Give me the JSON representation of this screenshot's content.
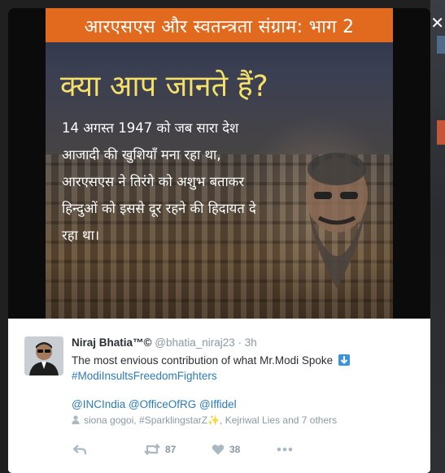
{
  "media": {
    "banner": "आरएसएस और स्वतन्त्रता संग्राम: भाग 2",
    "heading": "क्या आप जानते हैं?",
    "lines": [
      "14 अगस्त 1947 को जब सारा देश",
      "आजादी की खुशियाँ मना रहा था,",
      "आरएसएस ने तिरंगे को अशुभ बताकर",
      "हिन्दुओं को इससे दूर रहने की हिदायत दे",
      "रहा था।"
    ]
  },
  "tweet": {
    "name": "Niraj Bhatia™©",
    "handle": "@bhatia_niraj23",
    "separator": "·",
    "time": "3h",
    "text": "The most envious contribution of what Mr.Modi Spoke",
    "hashtag": "#ModiInsultsFreedomFighters",
    "mentions": "@INCIndia @OfficeOfRG @Iffidel",
    "liked_by_prefix": "siona gogoi, #SparklingstarZ",
    "liked_by_suffix": ", Kejriwal Lies and 7 others",
    "retweet_count": "87",
    "like_count": "38"
  },
  "icons": [
    "close-icon",
    "down-arrow-emoji-icon",
    "person-icon",
    "sparkles-emoji-icon",
    "reply-icon",
    "retweet-icon",
    "like-icon",
    "more-icon"
  ],
  "colors": {
    "accent": "#2b7bb9",
    "banner": "#e26a1e",
    "heading": "#f5e06a"
  }
}
